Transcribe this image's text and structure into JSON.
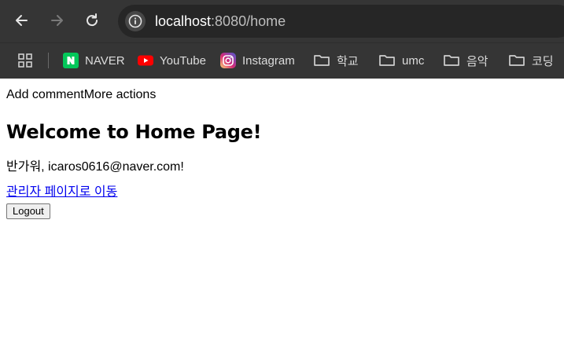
{
  "browser": {
    "url_host": "localhost",
    "url_rest": ":8080/home",
    "bookmarks": [
      {
        "label": "NAVER",
        "icon": "naver-icon"
      },
      {
        "label": "YouTube",
        "icon": "youtube-icon"
      },
      {
        "label": "Instagram",
        "icon": "instagram-icon"
      },
      {
        "label": "학교",
        "icon": "folder-icon"
      },
      {
        "label": "umc",
        "icon": "folder-icon"
      },
      {
        "label": "음악",
        "icon": "folder-icon"
      },
      {
        "label": "코딩",
        "icon": "folder-icon"
      }
    ],
    "colors": {
      "frame": "#353535",
      "omnibox": "#262626",
      "naver": "#03c75a",
      "youtube": "#ff0000"
    }
  },
  "page": {
    "add_comment": "Add comment",
    "more_actions": "More actions",
    "heading": "Welcome to Home Page!",
    "greeting": "반가워, icaros0616@naver.com!",
    "admin_link": "관리자 페이지로 이동",
    "logout_label": "Logout",
    "link_color": "#0000ee"
  }
}
